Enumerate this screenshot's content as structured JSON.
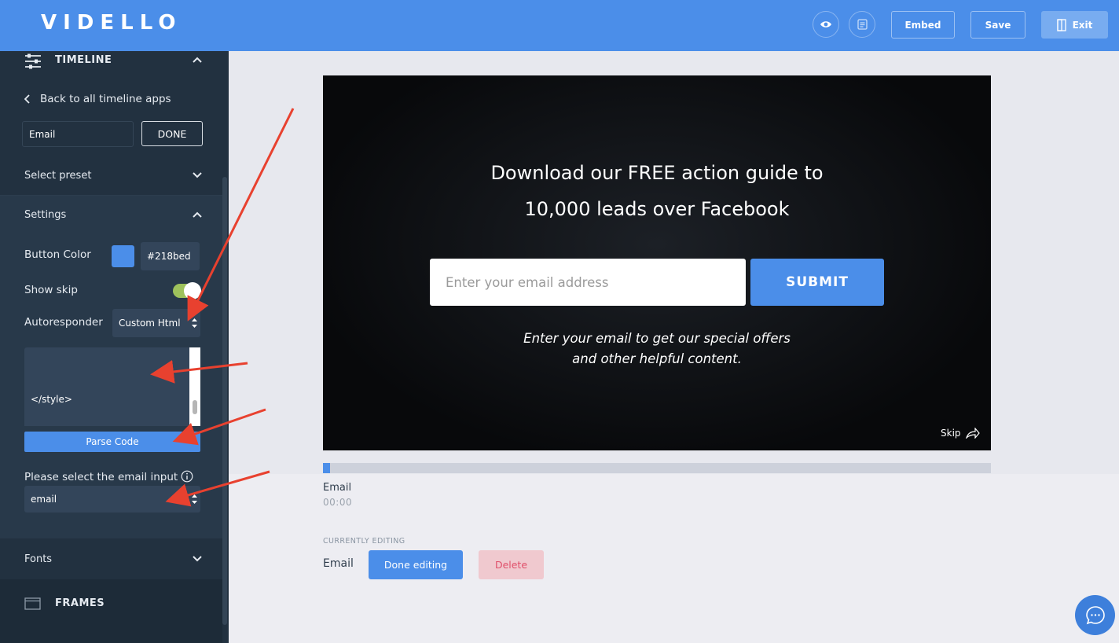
{
  "app": {
    "logo": "VIDELLO"
  },
  "toolbar": {
    "embed_label": "Embed",
    "save_label": "Save",
    "exit_label": "Exit"
  },
  "sidebar": {
    "timeline_title": "TIMELINE",
    "back_label": "Back to all timeline apps",
    "name_value": "Email",
    "done_label": "DONE",
    "preset_label": "Select preset",
    "settings_label": "Settings",
    "button_color_label": "Button Color",
    "button_color_value": "#218bed",
    "button_color_swatch": "#4b8ee9",
    "show_skip_label": "Show skip",
    "show_skip_on": true,
    "autoresponder_label": "Autoresponder",
    "autoresponder_value": "Custom Html",
    "code_text": "</style>",
    "parse_label": "Parse Code",
    "email_input_label": "Please select the email input",
    "email_input_value": "email",
    "fonts_label": "Fonts",
    "frames_label": "FRAMES"
  },
  "video": {
    "headline_line1": "Download our FREE action guide to",
    "headline_line2": "10,000 leads over Facebook",
    "email_placeholder": "Enter your email address",
    "submit_label": "SUBMIT",
    "sub_line1": "Enter your email to get our special offers",
    "sub_line2": "and other helpful content.",
    "skip_label": "Skip"
  },
  "timeline": {
    "progress_fraction": 0.01,
    "item_title": "Email",
    "item_time": "00:00"
  },
  "editing": {
    "caption": "CURRENTLY EDITING",
    "item": "Email",
    "done_label": "Done editing",
    "delete_label": "Delete"
  },
  "colors": {
    "accent": "#4b8ee9",
    "sidebar_bg": "#223140",
    "toggle_on": "#9ec25c",
    "delete_bg": "#f0c9cf",
    "delete_text": "#e0506a",
    "annotation_arrow": "#e8412f"
  }
}
